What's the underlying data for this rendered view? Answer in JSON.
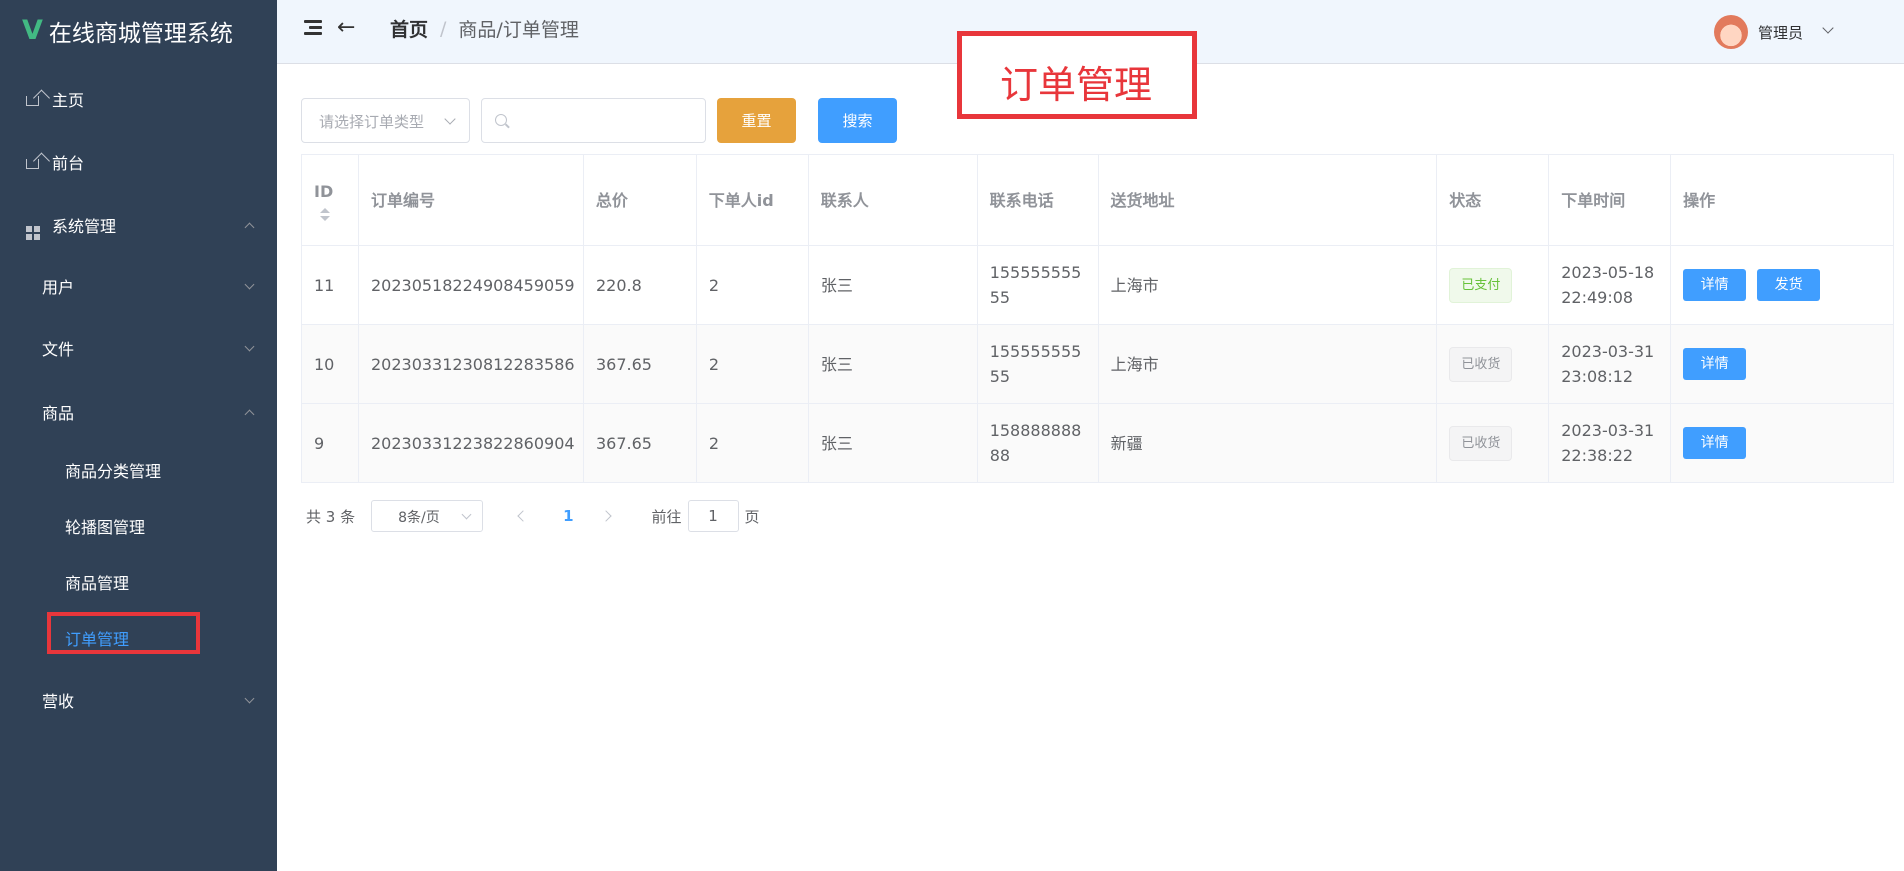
{
  "app": {
    "logo_letter": "V",
    "title": "在线商城管理系统"
  },
  "sidebar": {
    "items": [
      {
        "label": "主页"
      },
      {
        "label": "前台"
      },
      {
        "label": "系统管理"
      },
      {
        "label": "用户"
      },
      {
        "label": "文件"
      },
      {
        "label": "商品"
      },
      {
        "label": "商品分类管理"
      },
      {
        "label": "轮播图管理"
      },
      {
        "label": "商品管理"
      },
      {
        "label": "订单管理"
      },
      {
        "label": "营收"
      }
    ]
  },
  "header": {
    "breadcrumb_home": "首页",
    "breadcrumb_sep": "/",
    "breadcrumb_current": "商品/订单管理",
    "user_name": "管理员",
    "back_icon": "←"
  },
  "annotation": {
    "label": "订单管理",
    "color": "#e8363b"
  },
  "filter": {
    "select_placeholder": "请选择订单类型",
    "search_value": "",
    "reset_label": "重置",
    "search_label": "搜索"
  },
  "table": {
    "headers": [
      "ID",
      "订单编号",
      "总价",
      "下单人id",
      "联系人",
      "联系电话",
      "送货地址",
      "状态",
      "下单时间",
      "操作"
    ],
    "rows": [
      {
        "id": "11",
        "order_no": "20230518224908459059",
        "total": "220.8",
        "user_id": "2",
        "contact": "张三",
        "phone": "15555555555",
        "address": "上海市",
        "status": "已支付",
        "time": "2023-05-18 22:49:08",
        "detail": "详情",
        "ship": "发货"
      },
      {
        "id": "10",
        "order_no": "20230331230812283586",
        "total": "367.65",
        "user_id": "2",
        "contact": "张三",
        "phone": "15555555555",
        "address": "上海市",
        "status": "已收货",
        "time": "2023-03-31 23:08:12",
        "detail": "详情"
      },
      {
        "id": "9",
        "order_no": "20230331223822860904",
        "total": "367.65",
        "user_id": "2",
        "contact": "张三",
        "phone": "15888888888",
        "address": "新疆",
        "status": "已收货",
        "time": "2023-03-31 22:38:22",
        "detail": "详情"
      }
    ]
  },
  "pagination": {
    "total_text": "共 3 条",
    "page_size": "8条/页",
    "current_page": "1",
    "goto_label": "前往",
    "goto_value": "1",
    "page_suffix": "页"
  },
  "colors": {
    "sidebar_bg": "#304156",
    "primary": "#409eff",
    "warning": "#e6a23c",
    "success": "#67c23a",
    "logo": "#42b983"
  }
}
